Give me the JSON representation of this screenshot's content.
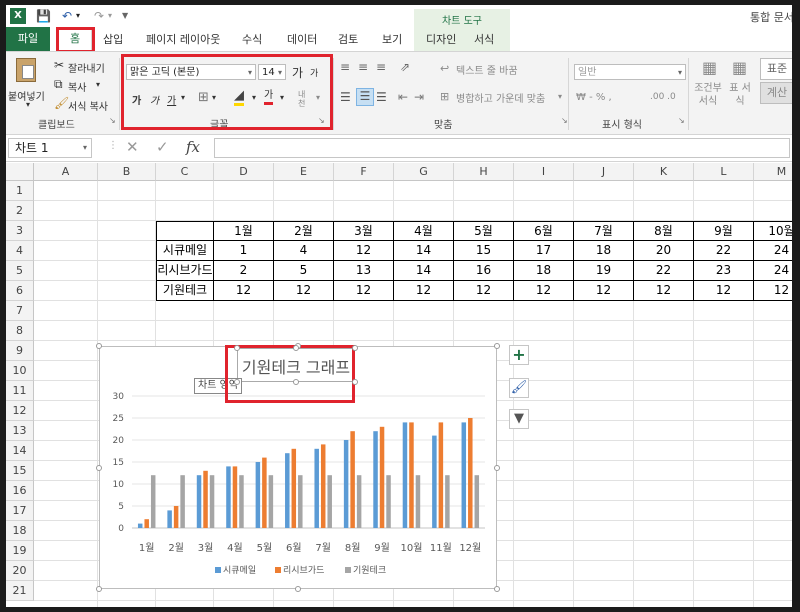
{
  "titlebar": {
    "title": "통합 문서",
    "excel_icon": "excel-icon",
    "save_icon": "save-icon",
    "undo_icon": "undo-icon",
    "redo_icon": "redo-icon"
  },
  "ribbon_tabs": {
    "file": "파일",
    "home": "홈",
    "insert": "삽입",
    "page_layout": "페이지 레이아웃",
    "formulas": "수식",
    "data": "데이터",
    "review": "검토",
    "view": "보기",
    "chart_tools": "차트 도구",
    "design": "디자인",
    "format": "서식"
  },
  "clipboard": {
    "paste": "붙여넣기",
    "cut": "잘라내기",
    "copy": "복사",
    "format_painter": "서식 복사",
    "label": "클립보드"
  },
  "font": {
    "name": "맑은 고딕 (본문)",
    "size": "14",
    "grow": "가",
    "shrink": "가",
    "bold": "가",
    "italic": "가",
    "underline": "가",
    "font_color": "가",
    "phonetic": "내천",
    "label": "글꼴"
  },
  "alignment": {
    "wrap": "텍스트 줄 바꿈",
    "merge": "병합하고 가운데 맞춤",
    "label": "맞춤"
  },
  "number": {
    "format": "일반",
    "currency": "₩ - % ,",
    "dec": ".00 .0",
    "label": "표시 형식"
  },
  "styles": {
    "conditional": "조건부 서식",
    "table": "표 서식",
    "normal": "표준",
    "calc": "계산"
  },
  "formula_bar": {
    "namebox": "차트 1",
    "fx": "fx"
  },
  "columns": [
    "A",
    "B",
    "C",
    "D",
    "E",
    "F",
    "G",
    "H",
    "I",
    "J",
    "K",
    "L",
    "M"
  ],
  "rows": [
    "1",
    "2",
    "3",
    "4",
    "5",
    "6",
    "7",
    "8",
    "9",
    "10",
    "11",
    "12",
    "13",
    "14",
    "15",
    "16",
    "17",
    "18",
    "19",
    "20",
    "21"
  ],
  "table": {
    "headers": [
      "",
      "1월",
      "2월",
      "3월",
      "4월",
      "5월",
      "6월",
      "7월",
      "8월",
      "9월",
      "10월"
    ],
    "rows": [
      [
        "시큐메일",
        "1",
        "4",
        "12",
        "14",
        "15",
        "17",
        "18",
        "20",
        "22",
        "24"
      ],
      [
        "리시브가드",
        "2",
        "5",
        "13",
        "14",
        "16",
        "18",
        "19",
        "22",
        "23",
        "24"
      ],
      [
        "기원테크",
        "12",
        "12",
        "12",
        "12",
        "12",
        "12",
        "12",
        "12",
        "12",
        "12"
      ]
    ]
  },
  "chart_tooltip": "차트 영역",
  "chart_data": {
    "type": "bar",
    "title": "기원테크 그래프",
    "categories": [
      "1월",
      "2월",
      "3월",
      "4월",
      "5월",
      "6월",
      "7월",
      "8월",
      "9월",
      "10월",
      "11월",
      "12월"
    ],
    "ylim": [
      0,
      30
    ],
    "yticks": [
      "0",
      "5",
      "10",
      "15",
      "20",
      "25",
      "30"
    ],
    "grid": true,
    "legend_position": "bottom",
    "series": [
      {
        "name": "시큐메일",
        "color": "#5b9bd5",
        "values": [
          1,
          4,
          12,
          14,
          15,
          17,
          18,
          20,
          22,
          24,
          21,
          24
        ]
      },
      {
        "name": "리시브가드",
        "color": "#ed7d31",
        "values": [
          2,
          5,
          13,
          14,
          16,
          18,
          19,
          22,
          23,
          24,
          24,
          25
        ]
      },
      {
        "name": "기원테크",
        "color": "#a5a5a5",
        "values": [
          12,
          12,
          12,
          12,
          12,
          12,
          12,
          12,
          12,
          12,
          12,
          12
        ]
      }
    ]
  },
  "chart_buttons": {
    "add": "+",
    "style": "brush-icon",
    "filter": "filter-icon"
  },
  "colors": {
    "excel_green": "#217346",
    "highlight_red": "#e0232d"
  }
}
